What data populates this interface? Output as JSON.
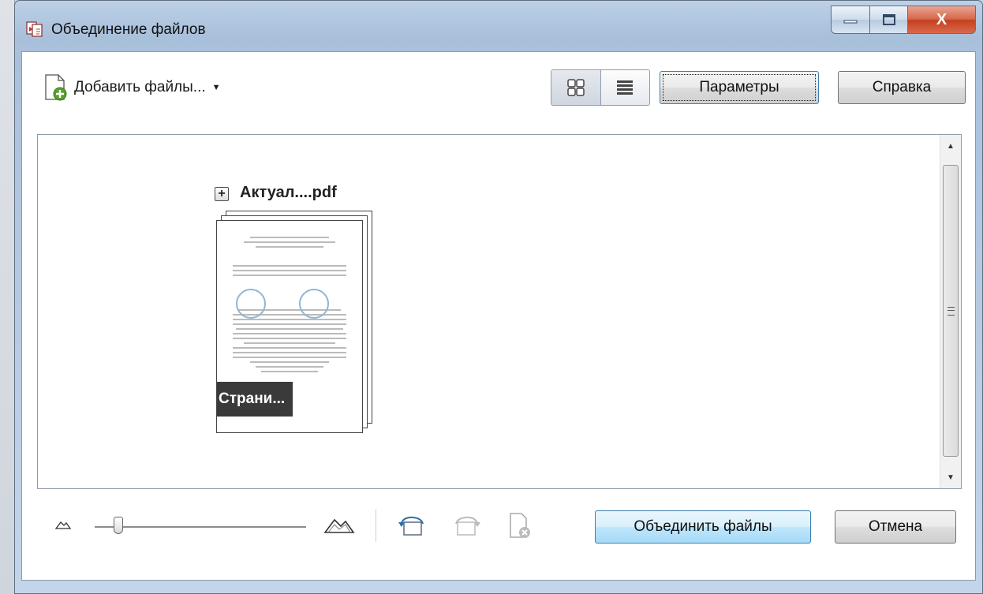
{
  "window": {
    "title": "Объединение файлов",
    "minimize_label": "",
    "maximize_label": "",
    "close_label": "X"
  },
  "toolbar": {
    "add_files_label": "Добавить файлы...",
    "add_files_arrow": "▼",
    "options_label": "Параметры",
    "help_label": "Справка"
  },
  "file_list": {
    "items": [
      {
        "name": "Актуал....pdf",
        "expand_symbol": "+",
        "page_label": "Страни..."
      }
    ]
  },
  "scrollbar": {
    "up": "▲",
    "down": "▼"
  },
  "bottom": {
    "combine_label": "Объединить файлы",
    "cancel_label": "Отмена",
    "zoom_level": 0.1
  },
  "colors": {
    "primary_button": "#bee6fd",
    "close_button": "#c4401f",
    "titlebar": "#a9c0db"
  }
}
